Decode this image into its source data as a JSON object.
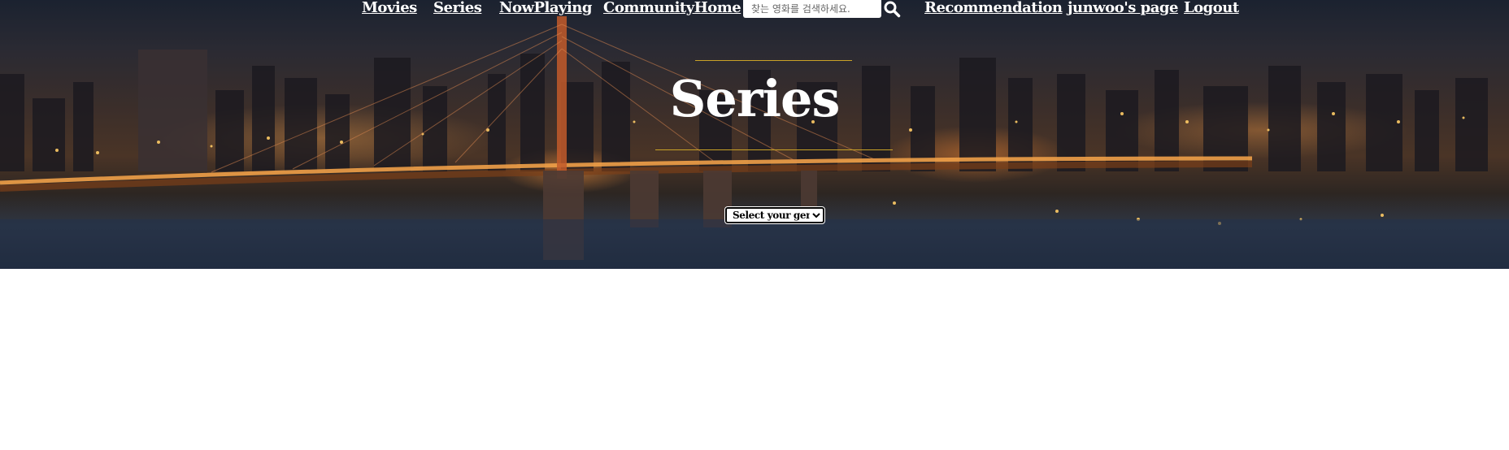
{
  "nav": {
    "items": [
      {
        "label": "Movies"
      },
      {
        "label": "Series"
      },
      {
        "label": "NowPlaying"
      },
      {
        "label": "CommunityHome"
      },
      {
        "label": "Recommendation"
      },
      {
        "label": "junwoo's page"
      },
      {
        "label": "Logout"
      }
    ],
    "search": {
      "placeholder": "찾는 영화를 검색하세요.",
      "value": "",
      "icon": "search-icon"
    }
  },
  "hero": {
    "title": "Series",
    "background": "night-city-bridge-skyline",
    "accent_color": "#c9a227"
  },
  "genre_select": {
    "selected": "Select your genre."
  }
}
